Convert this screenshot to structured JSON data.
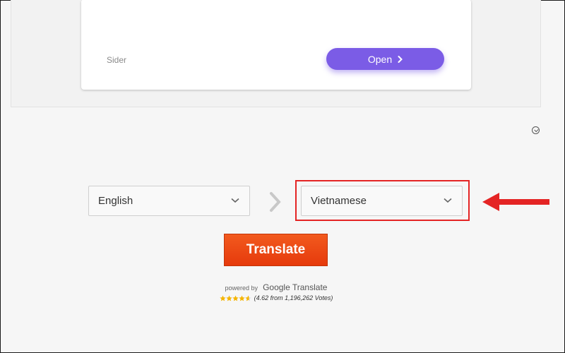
{
  "ad": {
    "sider_text": "Sider",
    "open_label": "Open"
  },
  "translator": {
    "source_language": "English",
    "target_language": "Vietnamese",
    "translate_label": "Translate"
  },
  "footer": {
    "powered_by": "powered by",
    "service": "Google Translate",
    "rating_text": "(4.62 from 1,196,262 Votes)",
    "stars": 4.62
  },
  "colors": {
    "open_button": "#7b5ce6",
    "translate_button": "#e94a14",
    "highlight": "#e42424",
    "star": "#f5b400"
  }
}
